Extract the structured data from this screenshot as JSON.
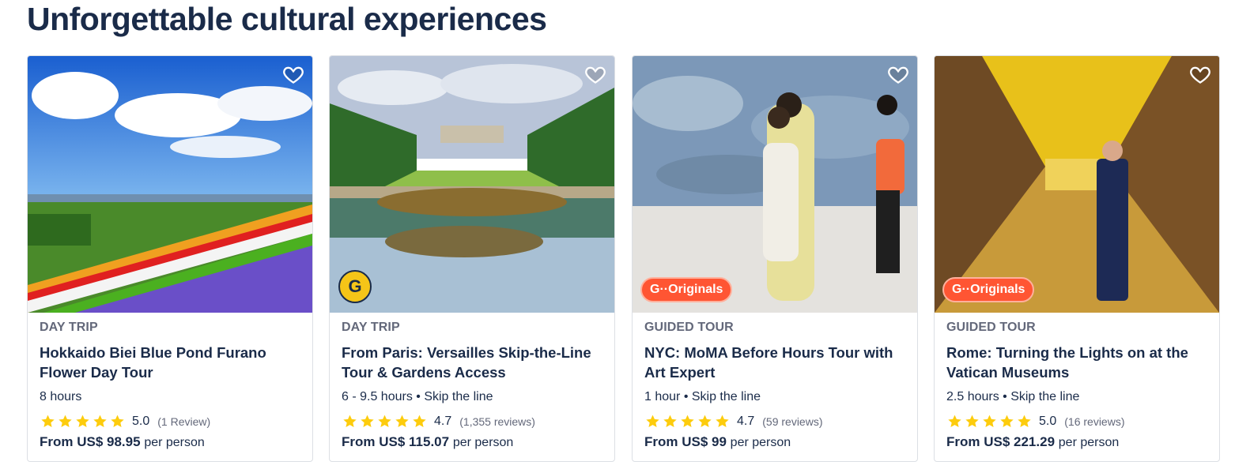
{
  "section": {
    "title": "Unforgettable cultural experiences"
  },
  "cards": [
    {
      "category": "DAY TRIP",
      "title": "Hokkaido Biei Blue Pond Furano Flower Day Tour",
      "meta": "8 hours",
      "rating": "5.0",
      "stars": 5,
      "reviews": "(1 Review)",
      "price_prefix": "From",
      "price": "US$ 98.95",
      "price_suffix": "per person",
      "badge": null
    },
    {
      "category": "DAY TRIP",
      "title": "From Paris: Versailles Skip-the-Line Tour & Gardens Access",
      "meta": "6 - 9.5 hours • Skip the line",
      "rating": "4.7",
      "stars": 5,
      "reviews": "(1,355 reviews)",
      "price_prefix": "From",
      "price": "US$ 115.07",
      "price_suffix": "per person",
      "badge": "G"
    },
    {
      "category": "GUIDED TOUR",
      "title": "NYC: MoMA Before Hours Tour with Art Expert",
      "meta": "1 hour • Skip the line",
      "rating": "4.7",
      "stars": 5,
      "reviews": "(59 reviews)",
      "price_prefix": "From",
      "price": "US$ 99",
      "price_suffix": "per person",
      "badge": "G··Originals"
    },
    {
      "category": "GUIDED TOUR",
      "title": "Rome: Turning the Lights on at the Vatican Museums",
      "meta": "2.5 hours • Skip the line",
      "rating": "5.0",
      "stars": 5,
      "reviews": "(16 reviews)",
      "price_prefix": "From",
      "price": "US$ 221.29",
      "price_suffix": "per person",
      "badge": "G··Originals"
    }
  ],
  "icons": {
    "wishlist": "heart-outline-icon",
    "star": "star-icon"
  },
  "colors": {
    "star": "#fdcc0d",
    "originals": "#ff5533",
    "text": "#1a2b49"
  }
}
